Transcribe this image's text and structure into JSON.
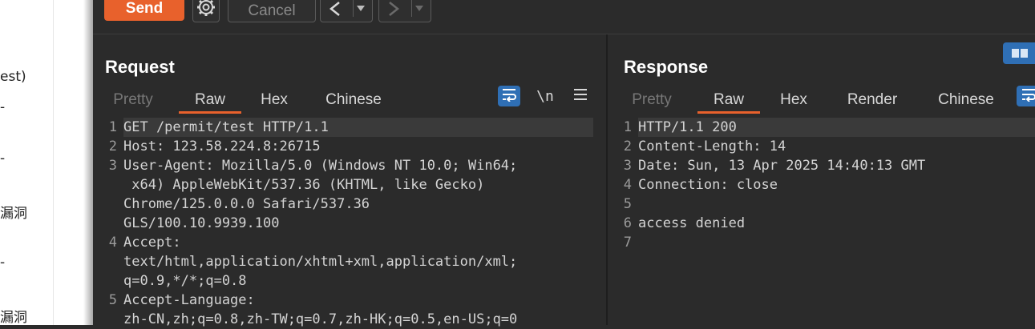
{
  "background_fragments": [
    "est)",
    "-",
    "-",
    "漏洞",
    "-",
    "漏洞"
  ],
  "toolbar": {
    "send_label": "Send",
    "cancel_label": "Cancel",
    "back_glyph": "<",
    "forward_glyph": ">"
  },
  "request": {
    "title": "Request",
    "tabs": [
      "Pretty",
      "Raw",
      "Hex",
      "Chinese"
    ],
    "active_tab": "Raw",
    "newline_label": "\\n",
    "lines": [
      {
        "num": "1",
        "text": "GET /permit/test HTTP/1.1"
      },
      {
        "num": "2",
        "text": "Host: 123.58.224.8:26715"
      },
      {
        "num": "3",
        "text": "User-Agent: Mozilla/5.0 (Windows NT 10.0; Win64;"
      },
      {
        "num": "",
        "text": " x64) AppleWebKit/537.36 (KHTML, like Gecko)"
      },
      {
        "num": "",
        "text": "Chrome/125.0.0.0 Safari/537.36"
      },
      {
        "num": "",
        "text": "GLS/100.10.9939.100"
      },
      {
        "num": "4",
        "text": "Accept:"
      },
      {
        "num": "",
        "text": "text/html,application/xhtml+xml,application/xml;"
      },
      {
        "num": "",
        "text": "q=0.9,*/*;q=0.8"
      },
      {
        "num": "5",
        "text": "Accept-Language:"
      },
      {
        "num": "",
        "text": "zh-CN,zh;q=0.8,zh-TW;q=0.7,zh-HK;q=0.5,en-US;q=0"
      }
    ]
  },
  "response": {
    "title": "Response",
    "tabs": [
      "Pretty",
      "Raw",
      "Hex",
      "Render",
      "Chinese"
    ],
    "active_tab": "Raw",
    "lines": [
      {
        "num": "1",
        "text": "HTTP/1.1 200"
      },
      {
        "num": "2",
        "text": "Content-Length: 14"
      },
      {
        "num": "3",
        "text": "Date: Sun, 13 Apr 2025 14:40:13 GMT"
      },
      {
        "num": "4",
        "text": "Connection: close"
      },
      {
        "num": "5",
        "text": ""
      },
      {
        "num": "6",
        "text": "access denied"
      },
      {
        "num": "7",
        "text": ""
      }
    ]
  },
  "colors": {
    "accent": "#e8612c",
    "blue": "#2f6fb5",
    "background": "#2b2b2b"
  }
}
